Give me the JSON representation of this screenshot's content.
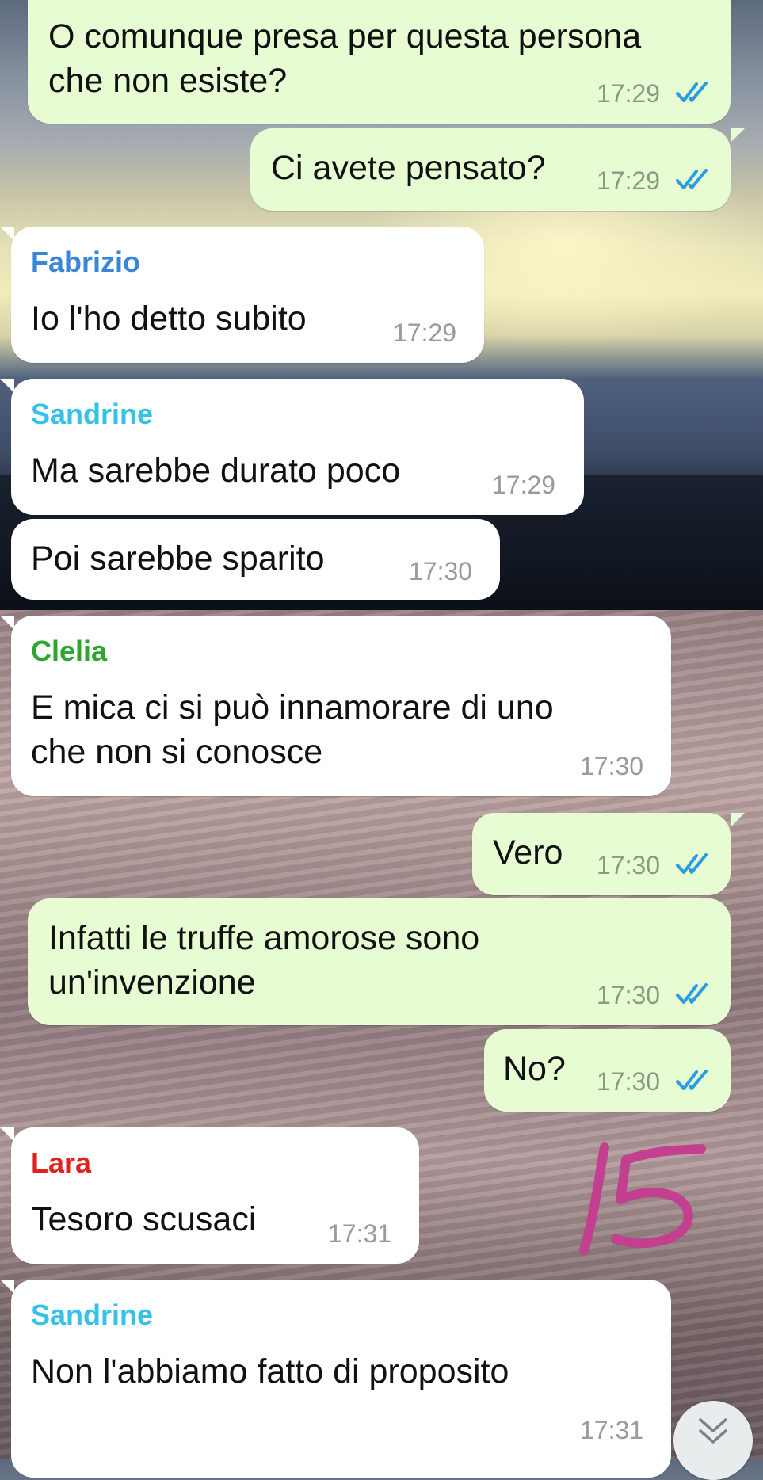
{
  "chat": {
    "messages": [
      {
        "direction": "outgoing",
        "text_lines": [
          "O comunque presa per questa persona",
          "che non esiste?"
        ],
        "time": "17:29",
        "status": "read"
      },
      {
        "direction": "outgoing",
        "text_lines": [
          "Ci avete pensato?"
        ],
        "time": "17:29",
        "status": "read"
      },
      {
        "direction": "incoming",
        "sender": "Fabrizio",
        "sender_color": "#3a86d6",
        "text_lines": [
          "Io l'ho detto subito"
        ],
        "time": "17:29"
      },
      {
        "direction": "incoming",
        "sender": "Sandrine",
        "sender_color": "#35c1e8",
        "text_lines": [
          "Ma sarebbe durato poco"
        ],
        "time": "17:29"
      },
      {
        "direction": "incoming",
        "text_lines": [
          "Poi sarebbe sparito"
        ],
        "time": "17:30"
      },
      {
        "direction": "incoming",
        "sender": "Clelia",
        "sender_color": "#2fa52f",
        "text_lines": [
          "E mica ci si può innamorare di uno",
          "che non si conosce"
        ],
        "time": "17:30"
      },
      {
        "direction": "outgoing",
        "text_lines": [
          "Vero"
        ],
        "time": "17:30",
        "status": "read"
      },
      {
        "direction": "outgoing",
        "text_lines": [
          "Infatti le truffe amorose sono",
          "un'invenzione"
        ],
        "time": "17:30",
        "status": "read"
      },
      {
        "direction": "outgoing",
        "text_lines": [
          "No?"
        ],
        "time": "17:30",
        "status": "read"
      },
      {
        "direction": "incoming",
        "sender": "Lara",
        "sender_color": "#e0221f",
        "text_lines": [
          "Tesoro scusaci"
        ],
        "time": "17:31"
      },
      {
        "direction": "incoming",
        "sender": "Sandrine",
        "sender_color": "#35c1e8",
        "text_lines": [
          "Non l'abbiamo fatto di proposito"
        ],
        "time": "17:31"
      }
    ]
  },
  "colors": {
    "incoming_bubble": "#ffffff",
    "outgoing_bubble": "#e7fcd3",
    "read_ticks": "#2a9de0",
    "scribble": "#c2408f"
  },
  "icons": {
    "read_status": "double-check-icon",
    "scroll_down": "double-chevron-down-icon",
    "annotation": "handwritten-15"
  },
  "annotation": {
    "text": "15"
  }
}
